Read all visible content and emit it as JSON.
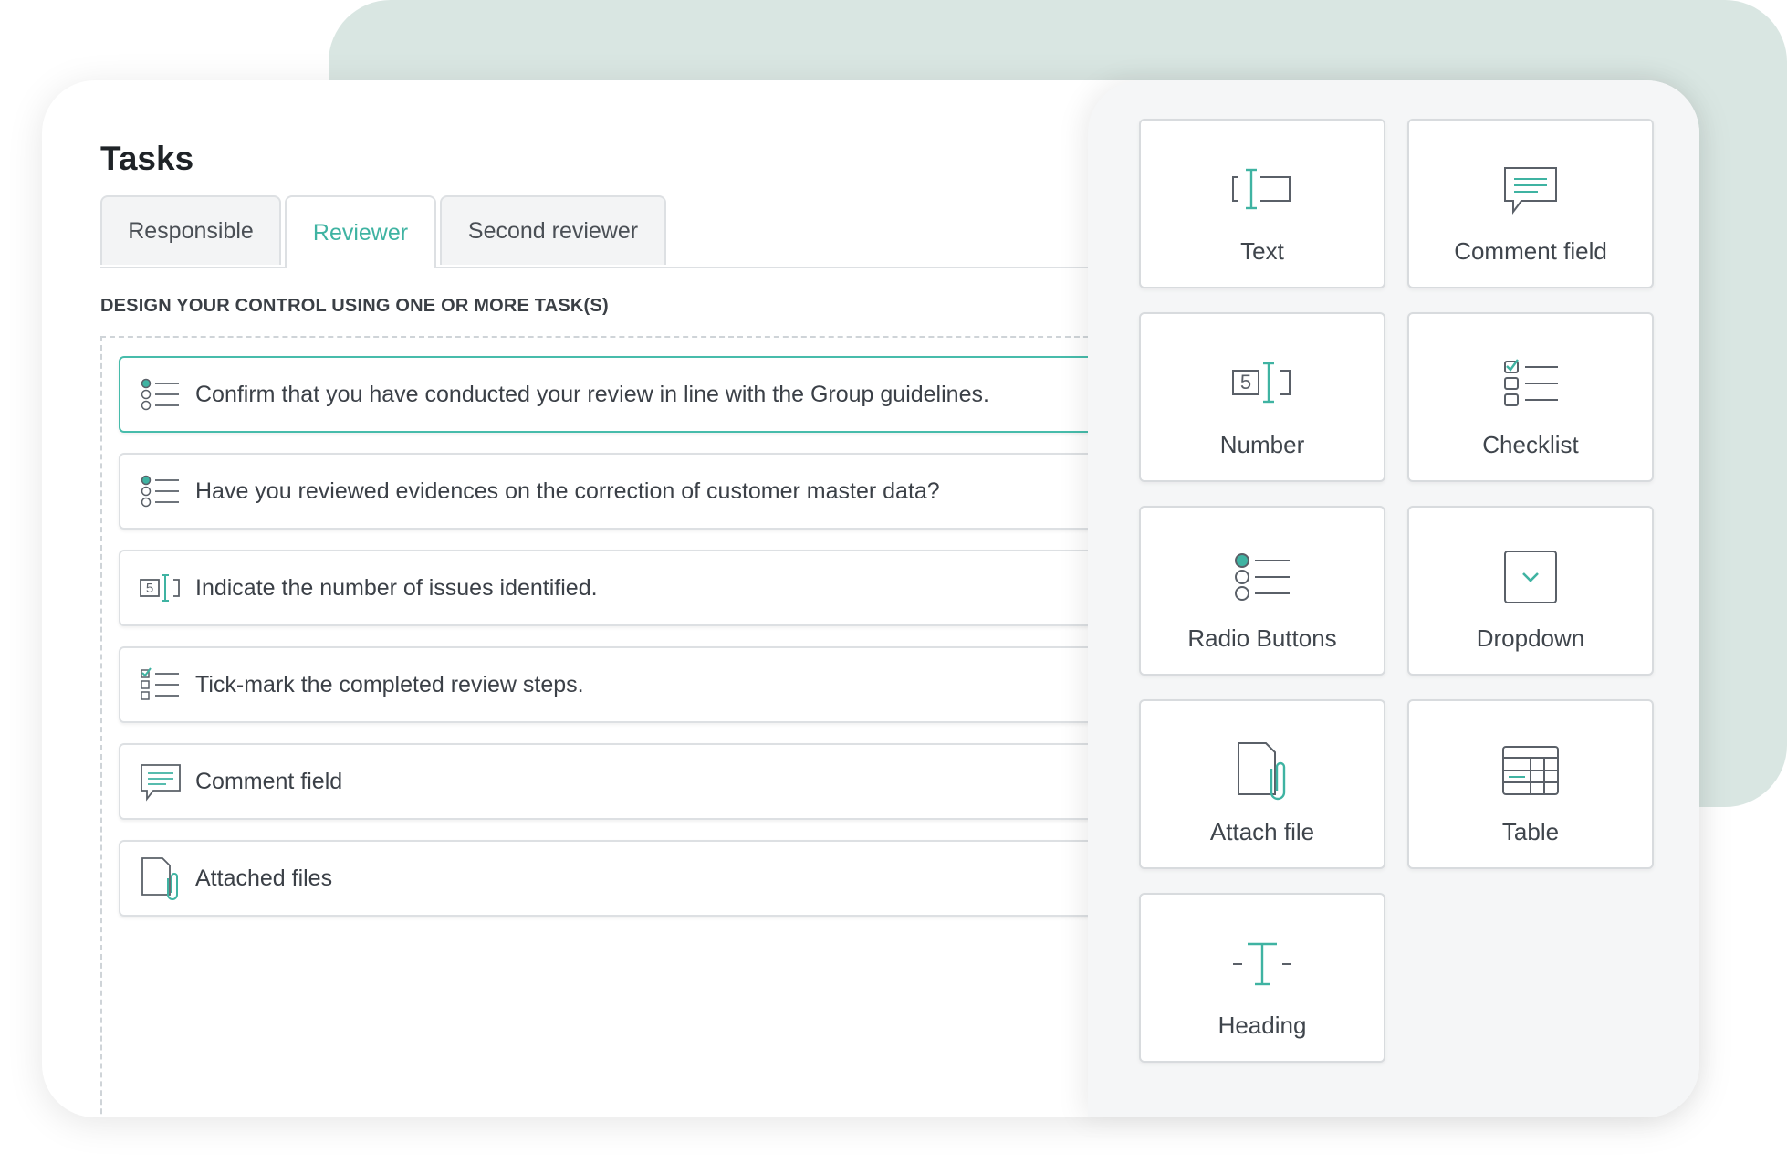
{
  "header": {
    "title": "Tasks"
  },
  "tabs": [
    {
      "label": "Responsible",
      "active": false
    },
    {
      "label": "Reviewer",
      "active": true
    },
    {
      "label": "Second reviewer",
      "active": false
    }
  ],
  "section_label": "DESIGN YOUR CONTROL USING ONE OR MORE TASK(S)",
  "tasks": [
    {
      "icon": "radio-list-icon",
      "label": "Confirm that you have conducted your review in line with the Group guidelines.",
      "selected": true
    },
    {
      "icon": "radio-list-icon",
      "label": "Have you reviewed evidences on the correction of customer master data?",
      "selected": false
    },
    {
      "icon": "number-field-icon",
      "label": "Indicate the number of issues identified.",
      "selected": false
    },
    {
      "icon": "checklist-icon",
      "label": "Tick-mark the completed review steps.",
      "selected": false
    },
    {
      "icon": "comment-icon",
      "label": "Comment field",
      "selected": false
    },
    {
      "icon": "attach-file-icon",
      "label": "Attached files",
      "selected": false
    }
  ],
  "palette": [
    {
      "icon": "text-field-icon",
      "label": "Text"
    },
    {
      "icon": "comment-icon",
      "label": "Comment field"
    },
    {
      "icon": "number-field-icon",
      "label": "Number"
    },
    {
      "icon": "checklist-icon",
      "label": "Checklist"
    },
    {
      "icon": "radio-list-icon",
      "label": "Radio Buttons"
    },
    {
      "icon": "dropdown-icon",
      "label": "Dropdown"
    },
    {
      "icon": "attach-file-icon",
      "label": "Attach file"
    },
    {
      "icon": "table-icon",
      "label": "Table"
    },
    {
      "icon": "heading-icon",
      "label": "Heading"
    }
  ],
  "colors": {
    "accent": "#3fb3a2",
    "icon_stroke": "#5a6068",
    "backdrop": "#d9e6e2"
  }
}
